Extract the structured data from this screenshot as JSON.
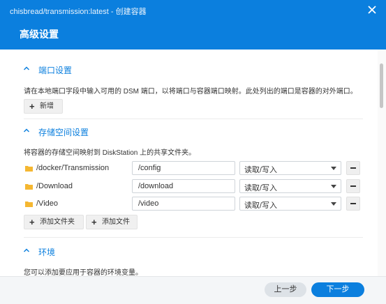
{
  "window": {
    "title": "chisbread/transmission:latest - 创建容器"
  },
  "dialog": {
    "title": "高级设置"
  },
  "ports": {
    "header": "端口设置",
    "description": "请在本地端口字段中输入可用的 DSM 端口，以将端口与容器端口映射。此处列出的端口是容器的对外端口。",
    "add_label": "新增"
  },
  "storage": {
    "header": "存储空间设置",
    "description": "将容器的存储空间映射到 DiskStation 上的共享文件夹。",
    "rows": [
      {
        "folder": "/docker/Transmission",
        "mount": "/config",
        "permission": "读取/写入"
      },
      {
        "folder": "/Download",
        "mount": "/download",
        "permission": "读取/写入"
      },
      {
        "folder": "/Video",
        "mount": "/video",
        "permission": "读取/写入"
      }
    ],
    "add_folder_label": "添加文件夹",
    "add_file_label": "添加文件"
  },
  "env": {
    "header": "环境",
    "description": "您可以添加要应用于容器的环境变量。"
  },
  "footer": {
    "back_label": "上一步",
    "next_label": "下一步"
  },
  "colors": {
    "accent": "#0b7fde",
    "folder": "#f5b731",
    "footer_bg": "#f4f6f8"
  },
  "icons": [
    "close-icon",
    "chevron-up-icon",
    "plus-icon",
    "folder-icon",
    "dropdown-caret-icon",
    "minus-icon"
  ]
}
